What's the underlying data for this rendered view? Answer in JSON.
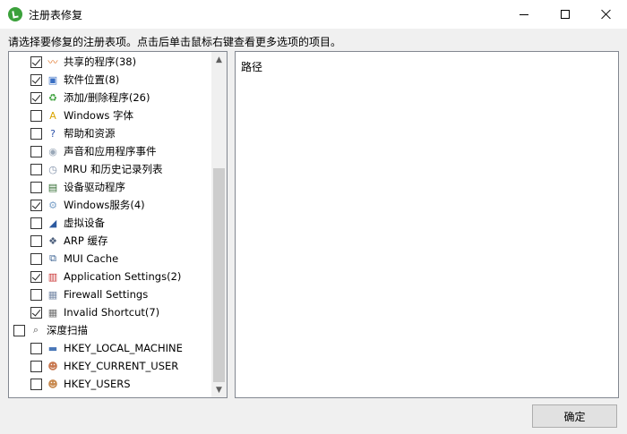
{
  "window": {
    "title": "注册表修复"
  },
  "instruction": "请选择要修复的注册表项。点击后单击鼠标右键查看更多选项的项目。",
  "tree_items": [
    {
      "label": "共享的程序(38)",
      "checked": true,
      "indent": 1,
      "icon": "shared-program-icon",
      "icon_color": "#e07020",
      "glyph": "〰"
    },
    {
      "label": "软件位置(8)",
      "checked": true,
      "indent": 1,
      "icon": "software-location-icon",
      "icon_color": "#3a6fc4",
      "glyph": "▣"
    },
    {
      "label": "添加/删除程序(26)",
      "checked": true,
      "indent": 1,
      "icon": "recycle-icon",
      "icon_color": "#3aa03a",
      "glyph": "♻"
    },
    {
      "label": "Windows 字体",
      "checked": false,
      "indent": 1,
      "icon": "font-icon",
      "icon_color": "#d9a400",
      "glyph": "A"
    },
    {
      "label": "帮助和资源",
      "checked": false,
      "indent": 1,
      "icon": "help-icon",
      "icon_color": "#2a4fa8",
      "glyph": "?"
    },
    {
      "label": "声音和应用程序事件",
      "checked": false,
      "indent": 1,
      "icon": "sound-icon",
      "icon_color": "#9aa8b8",
      "glyph": "◉"
    },
    {
      "label": "MRU 和历史记录列表",
      "checked": false,
      "indent": 1,
      "icon": "history-icon",
      "icon_color": "#8090a8",
      "glyph": "◷"
    },
    {
      "label": "设备驱动程序",
      "checked": false,
      "indent": 1,
      "icon": "driver-icon",
      "icon_color": "#2f6b2f",
      "glyph": "▤"
    },
    {
      "label": "Windows服务(4)",
      "checked": true,
      "indent": 1,
      "icon": "services-icon",
      "icon_color": "#7aa0c8",
      "glyph": "⚙"
    },
    {
      "label": "虚拟设备",
      "checked": false,
      "indent": 1,
      "icon": "virtual-device-icon",
      "icon_color": "#2d5aa0",
      "glyph": "◢"
    },
    {
      "label": "ARP 缓存",
      "checked": false,
      "indent": 1,
      "icon": "arp-cache-icon",
      "icon_color": "#4a5d7a",
      "glyph": "❖"
    },
    {
      "label": "MUI Cache",
      "checked": false,
      "indent": 1,
      "icon": "mui-cache-icon",
      "icon_color": "#3a6090",
      "glyph": "⧉"
    },
    {
      "label": "Application Settings(2)",
      "checked": true,
      "indent": 1,
      "icon": "app-settings-icon",
      "icon_color": "#c83030",
      "glyph": "▥"
    },
    {
      "label": "Firewall Settings",
      "checked": false,
      "indent": 1,
      "icon": "firewall-icon",
      "icon_color": "#7a8ca8",
      "glyph": "▦"
    },
    {
      "label": "Invalid Shortcut(7)",
      "checked": true,
      "indent": 1,
      "icon": "shortcut-icon",
      "icon_color": "#707070",
      "glyph": "▦"
    },
    {
      "label": "深度扫描",
      "checked": false,
      "indent": 0,
      "icon": "magnifier-icon",
      "icon_color": "#555555",
      "glyph": "⌕"
    },
    {
      "label": "HKEY_LOCAL_MACHINE",
      "checked": false,
      "indent": 1,
      "icon": "computer-icon",
      "icon_color": "#4a78b8",
      "glyph": "▬"
    },
    {
      "label": "HKEY_CURRENT_USER",
      "checked": false,
      "indent": 1,
      "icon": "user-icon",
      "icon_color": "#c87850",
      "glyph": "☻"
    },
    {
      "label": "HKEY_USERS",
      "checked": false,
      "indent": 1,
      "icon": "users-icon",
      "icon_color": "#c88a50",
      "glyph": "☻"
    }
  ],
  "detail": {
    "path_label": "路径"
  },
  "buttons": {
    "ok_label": "确定"
  }
}
